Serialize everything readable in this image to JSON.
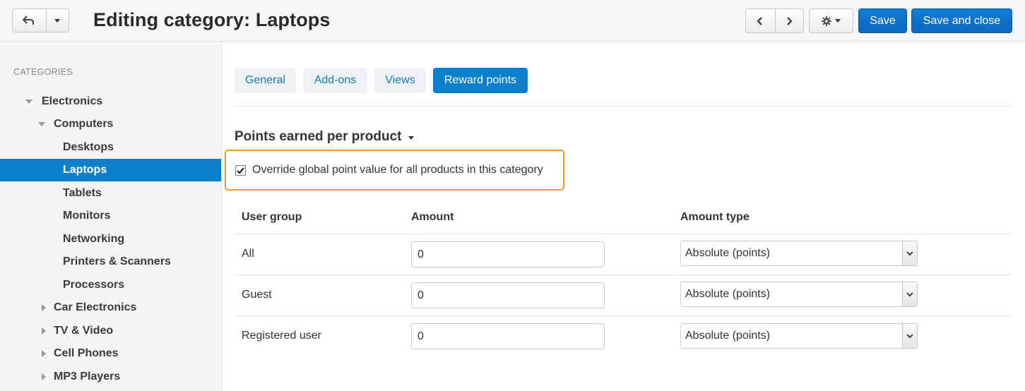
{
  "header": {
    "title": "Editing category: Laptops",
    "save_label": "Save",
    "save_close_label": "Save and close"
  },
  "sidebar": {
    "heading": "CATEGORIES",
    "items": [
      {
        "label": "Electronics",
        "toggle": "expanded"
      },
      {
        "label": "Computers",
        "toggle": "expanded"
      },
      {
        "label": "Desktops"
      },
      {
        "label": "Laptops",
        "active": true
      },
      {
        "label": "Tablets"
      },
      {
        "label": "Monitors"
      },
      {
        "label": "Networking"
      },
      {
        "label": "Printers & Scanners"
      },
      {
        "label": "Processors"
      },
      {
        "label": "Car Electronics",
        "toggle": "collapsed"
      },
      {
        "label": "TV & Video",
        "toggle": "collapsed"
      },
      {
        "label": "Cell Phones",
        "toggle": "collapsed"
      },
      {
        "label": "MP3 Players",
        "toggle": "collapsed"
      }
    ]
  },
  "tabs": [
    {
      "label": "General"
    },
    {
      "label": "Add-ons"
    },
    {
      "label": "Views"
    },
    {
      "label": "Reward points",
      "active": true
    }
  ],
  "section": {
    "title": "Points earned per product",
    "override_label": "Override global point value for all products in this category",
    "override_checked": true
  },
  "table": {
    "headers": [
      "User group",
      "Amount",
      "Amount type"
    ],
    "rows": [
      {
        "group": "All",
        "amount": "0",
        "type": "Absolute (points)"
      },
      {
        "group": "Guest",
        "amount": "0",
        "type": "Absolute (points)"
      },
      {
        "group": "Registered user",
        "amount": "0",
        "type": "Absolute (points)"
      }
    ]
  },
  "colors": {
    "primary": "#0b7fcc",
    "highlight_border": "#f0962c",
    "link": "#1a7cc1"
  }
}
